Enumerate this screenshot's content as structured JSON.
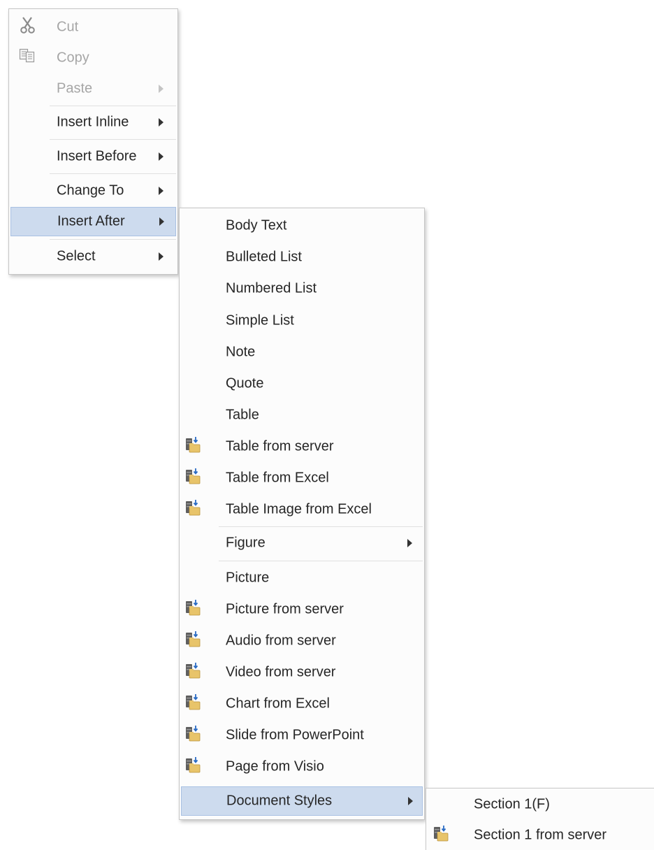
{
  "main_menu": {
    "items": [
      {
        "label": "Cut",
        "disabled": true,
        "icon": "scissors-icon"
      },
      {
        "label": "Copy",
        "disabled": true,
        "icon": "copy-icon"
      },
      {
        "label": "Paste",
        "disabled": true,
        "submenu": true
      },
      {
        "label": "Insert Inline",
        "submenu": true
      },
      {
        "label": "Insert Before",
        "submenu": true
      },
      {
        "label": "Change To",
        "submenu": true
      },
      {
        "label": "Insert After",
        "submenu": true,
        "highlighted": true
      },
      {
        "label": "Select",
        "submenu": true
      }
    ]
  },
  "insert_after_menu": {
    "items": [
      {
        "label": "Body Text"
      },
      {
        "label": "Bulleted List"
      },
      {
        "label": "Numbered List"
      },
      {
        "label": "Simple List"
      },
      {
        "label": "Note"
      },
      {
        "label": "Quote"
      },
      {
        "label": "Table"
      },
      {
        "label": "Table from server",
        "icon": "server-import-icon"
      },
      {
        "label": "Table from Excel",
        "icon": "server-import-icon"
      },
      {
        "label": "Table Image from Excel",
        "icon": "server-import-icon"
      },
      {
        "label": "Figure",
        "submenu": true
      },
      {
        "label": "Picture"
      },
      {
        "label": "Picture from server",
        "icon": "server-import-icon"
      },
      {
        "label": "Audio from server",
        "icon": "server-import-icon"
      },
      {
        "label": "Video from server",
        "icon": "server-import-icon"
      },
      {
        "label": "Chart from Excel",
        "icon": "server-import-icon"
      },
      {
        "label": "Slide from PowerPoint",
        "icon": "server-import-icon"
      },
      {
        "label": "Page from Visio",
        "icon": "server-import-icon"
      },
      {
        "label": "Document Styles",
        "submenu": true,
        "highlighted": true
      }
    ]
  },
  "document_styles_menu": {
    "items": [
      {
        "label": "Section 1(F)"
      },
      {
        "label": "Section 1 from server",
        "icon": "server-import-icon"
      }
    ]
  },
  "colors": {
    "highlight_bg": "#cddbee",
    "highlight_border": "#a9c1e3",
    "disabled_text": "#a6a6a6",
    "menu_bg": "#fcfcfc"
  }
}
